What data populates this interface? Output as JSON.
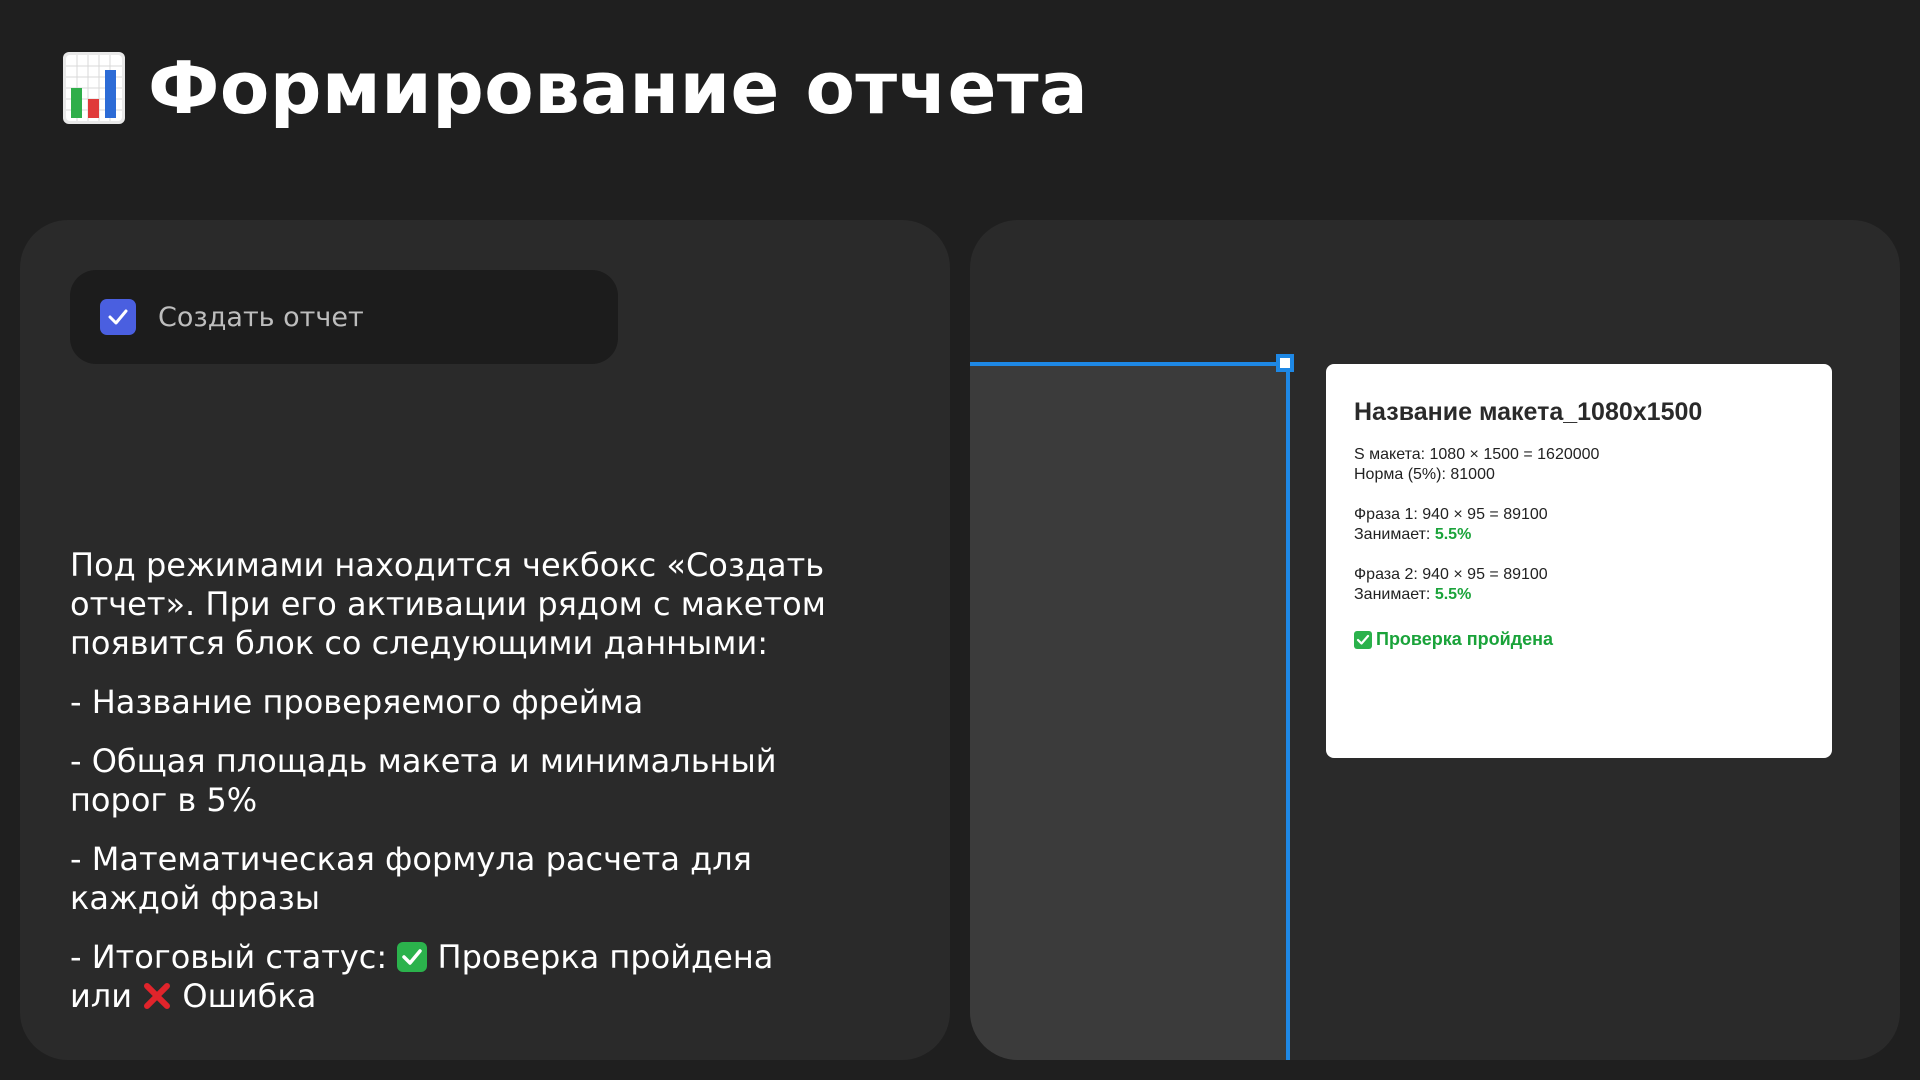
{
  "header": {
    "icon": "bar-chart-icon",
    "title": "Формирование отчета"
  },
  "left_card": {
    "checkbox": {
      "label": "Создать отчет",
      "checked": true,
      "color": "#4a5fe0"
    },
    "description": {
      "intro": "Под режимами находится чекбокс «Создать отчет». При его активации рядом с макетом появится блок со следующими данными:",
      "item1": "- Название проверяемого фрейма",
      "item2": "- Общая площадь макета и минимальный порог в 5%",
      "item3": "- Математическая формула расчета для каждой фразы",
      "item4_prefix": "- Итоговый статус:",
      "item4_pass": "Проверка пройдена",
      "item4_or": "или",
      "item4_fail": "Ошибка"
    }
  },
  "report": {
    "title": "Название макета_1080x1500",
    "area": "S макета: 1080 × 1500 = 1620000",
    "norm": "Норма (5%): 81000",
    "phrase1_formula": "Фраза 1: 940 × 95 = 89100",
    "phrase1_occupies_label": "Занимает:",
    "phrase1_percent": "5.5%",
    "phrase2_formula": "Фраза 2: 940 × 95 = 89100",
    "phrase2_occupies_label": "Занимает:",
    "phrase2_percent": "5.5%",
    "status": "Проверка пройдена",
    "status_color": "#1aa33a"
  },
  "colors": {
    "background": "#1f1f1f",
    "card": "#2a2a2a",
    "selection": "#1e88e5"
  }
}
